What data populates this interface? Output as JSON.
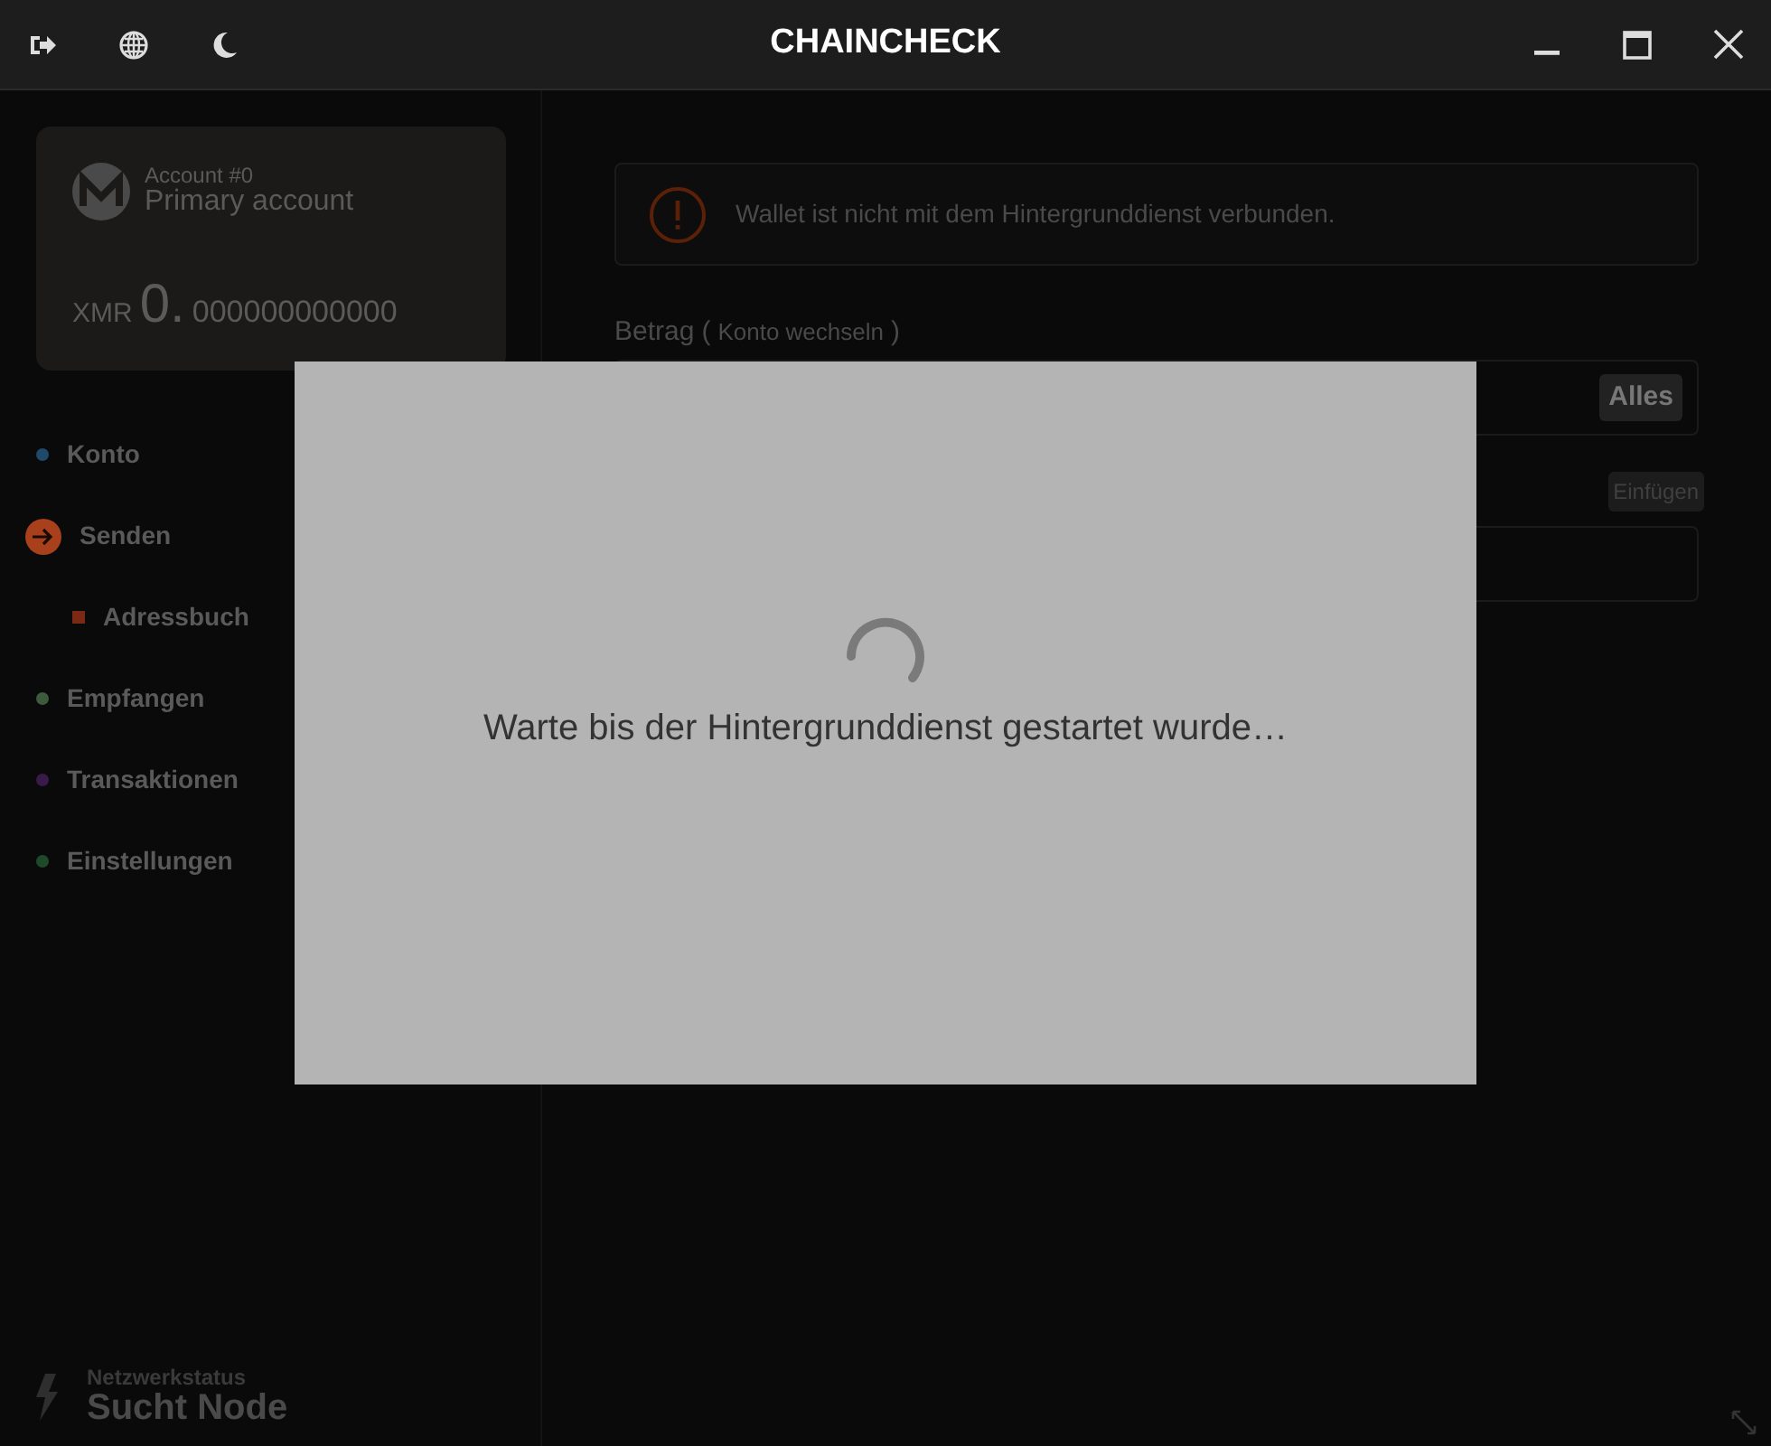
{
  "window": {
    "title": "CHAINCHECK"
  },
  "account": {
    "label": "Account #0",
    "name": "Primary account",
    "currency": "XMR",
    "balance_int": "0.",
    "balance_dec": "000000000000"
  },
  "sidebar": {
    "items": [
      {
        "label": "Konto",
        "selected": false,
        "color": "#1f4a6b"
      },
      {
        "label": "Senden",
        "selected": true,
        "color": "#a8401c",
        "children": [
          {
            "label": "Adressbuch",
            "selected": false,
            "color": "#7a2a14"
          }
        ]
      },
      {
        "label": "Empfangen",
        "selected": false,
        "color": "#3d5a3d"
      },
      {
        "label": "Transaktionen",
        "selected": false,
        "color": "#3a1a4a"
      },
      {
        "label": "Einstellungen",
        "selected": false,
        "color": "#1f4a2a"
      }
    ]
  },
  "network": {
    "label": "Netzwerkstatus",
    "status": "Sucht Node"
  },
  "alert": {
    "text": "Wallet ist nicht mit dem Hintergrunddienst verbunden."
  },
  "amount": {
    "label": "Betrag",
    "open_paren": "(",
    "link": "Konto wechseln",
    "close_paren": ")",
    "all_button": "Alles"
  },
  "address": {
    "paste_button": "Einfügen"
  },
  "modal": {
    "message": "Warte bis der Hintergrunddienst gestartet wurde…"
  }
}
